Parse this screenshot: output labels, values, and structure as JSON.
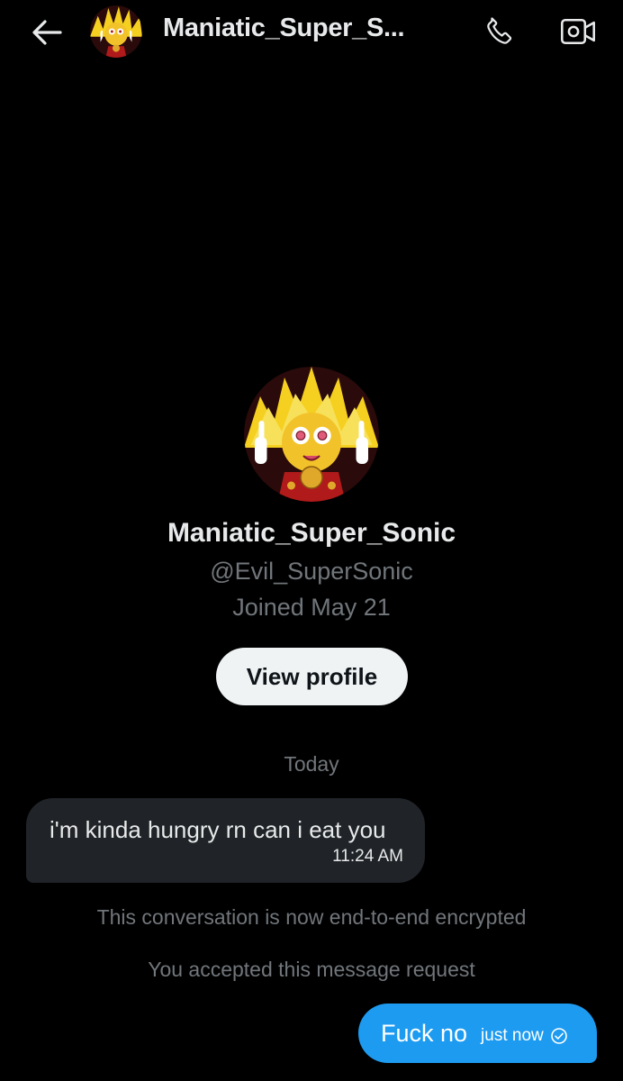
{
  "header": {
    "title": "Maniatic_Super_S...",
    "back_icon": "arrow-left-icon",
    "avatar_icon": "avatar",
    "call_icon": "phone-icon",
    "video_icon": "video-camera-icon"
  },
  "profile": {
    "name": "Maniatic_Super_Sonic",
    "handle": "@Evil_SuperSonic",
    "joined": "Joined May 21",
    "view_profile_label": "View profile"
  },
  "conversation": {
    "date_label": "Today",
    "incoming": {
      "text": "i'm kinda hungry rn can i eat you",
      "time": "11:24 AM"
    },
    "system_messages": [
      "This conversation is now end-to-end encrypted",
      "You accepted this message request"
    ],
    "outgoing": {
      "text": "Fuck no",
      "time": "just now",
      "status_icon": "seen-check-icon"
    }
  },
  "colors": {
    "background": "#000000",
    "primary_text": "#e7e9ea",
    "secondary_text": "#71767b",
    "incoming_bubble": "#202327",
    "outgoing_bubble": "#1d9bf0",
    "button_bg": "#eff3f4",
    "avatar_yellow": "#f5d020",
    "avatar_red": "#b01a1a"
  }
}
